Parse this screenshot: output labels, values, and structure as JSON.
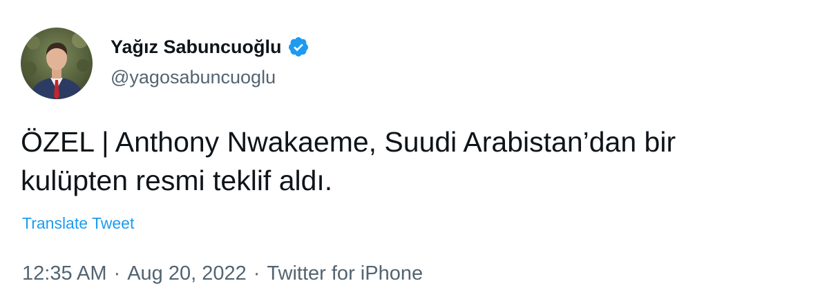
{
  "author": {
    "display_name": "Yağız Sabuncuoğlu",
    "handle": "@yagosabuncuoglu",
    "verified_icon": "verified-badge-icon"
  },
  "tweet": {
    "text": "ÖZEL | Anthony Nwakaeme, Suudi Arabistan’dan bir\nkulüpten resmi teklif aldı.",
    "translate_label": "Translate Tweet"
  },
  "meta": {
    "time": "12:35 AM",
    "separator": "·",
    "date": "Aug 20, 2022",
    "source": "Twitter for iPhone"
  },
  "colors": {
    "accent": "#1d9bf0",
    "text": "#0f1419",
    "secondary": "#536471"
  }
}
